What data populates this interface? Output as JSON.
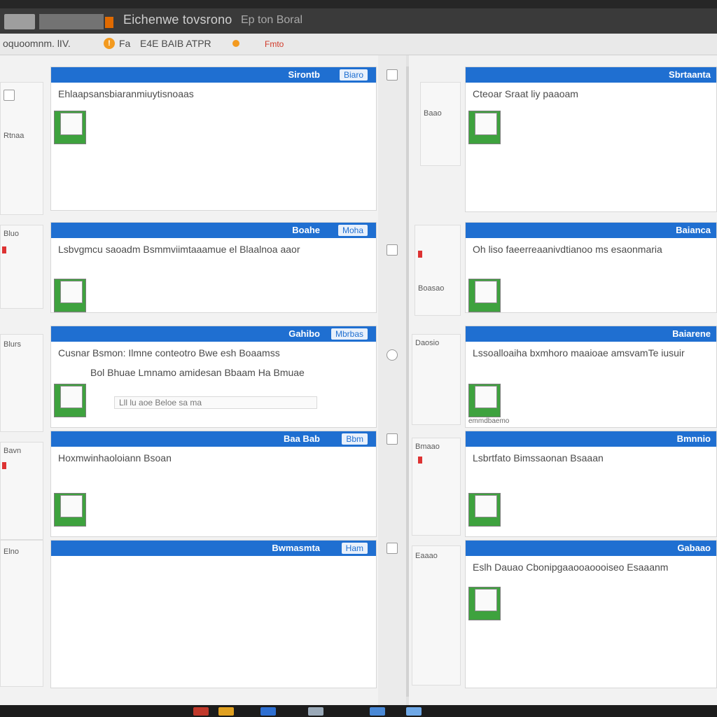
{
  "window": {
    "title": "Eichenwe tovsrono",
    "subtitle": "Ep ton Boral"
  },
  "toolbar": {
    "path_text": "oquoomnm. lIV.",
    "menu1": "Fa",
    "menu2": "E4E BAIB ATPR",
    "status_text": "Fmto",
    "warn_icon": "warning-icon"
  },
  "panels": [
    {
      "id": "p1",
      "header": "Sirontb",
      "header_btn": "Biaro",
      "title": "Ehlaapsansbiaranmiuytisnoaas",
      "thumb": "image-thumbnail"
    },
    {
      "id": "p2",
      "header": "Sbrtaanta",
      "title": "Cteoar Sraat liy paaoam",
      "thumb": "image-thumbnail"
    },
    {
      "id": "p3",
      "header": "Boahe",
      "header_btn": "Moha",
      "title": "Lsbvgmcu saoadm Bsmmviimtaaamue el Blaalnoa aaor",
      "thumb": "image-thumbnail"
    },
    {
      "id": "p4",
      "header": "Baianca",
      "title": "Oh liso faeerreaanivdtianoo ms esaonmaria",
      "thumb": "image-thumbnail"
    },
    {
      "id": "p5",
      "header": "Gahibo",
      "header_btn": "Mbrbas",
      "title": "Cusnar Bsmon: Ilmne conteotro Bwe esh Boaamss",
      "subtitle": "Bol Bhuae Lmnamo amidesan Bbaam Ha Bmuae",
      "input": "Lll lu aoe  Beloe sa ma",
      "thumb": "image-thumbnail"
    },
    {
      "id": "p6",
      "header": "Baiarene",
      "title": "Lssoalloaiha bxmhoro maaioae amsvamTe iusuir",
      "thumb": "image-thumbnail",
      "caption": "emmdbaemo"
    },
    {
      "id": "p7",
      "header": "Baa Bab",
      "header_btn": "Bbm",
      "title": "Hoxmwinhaoloiann Bsoan",
      "thumb": "image-thumbnail"
    },
    {
      "id": "p8",
      "header": "Bmnnio",
      "title": "Lsbrtfato Bimssaonan Bsaaan",
      "thumb": "image-thumbnail"
    },
    {
      "id": "p9",
      "header": "Bwmasmta",
      "header_btn": "Ham",
      "title": "",
      "thumb": "image-thumbnail"
    },
    {
      "id": "p10",
      "header": "Gabaao",
      "title": "Eslh Dauao Cbonipgaaooaoooiseo Esaaanm",
      "thumb": "image-thumbnail"
    }
  ],
  "left_sidebar": [
    {
      "label": "Rtnaa",
      "icon": "list-icon"
    },
    {
      "label": "Bluo",
      "icon": "list-icon"
    },
    {
      "label": "Blurs",
      "icon": "list-icon"
    },
    {
      "label": "Bavn",
      "icon": "list-icon"
    },
    {
      "label": "Elno",
      "icon": "list-icon"
    }
  ],
  "mid_sidebar": [
    {
      "label": "Baao",
      "icon": "document-icon"
    },
    {
      "label": "Boasao",
      "icon": "document-icon"
    },
    {
      "label": "Daosio",
      "icon": "document-icon"
    },
    {
      "label": "Bmaao",
      "icon": "document-icon"
    },
    {
      "label": "Eaaao",
      "icon": "document-icon"
    }
  ],
  "taskbar": {
    "icons": [
      "app-icon",
      "folder-icon",
      "browser-icon",
      "mail-icon",
      "app-icon",
      "app-icon"
    ]
  },
  "colors": {
    "header_blue": "#1f6fd1",
    "thumb_green": "#3ea23e",
    "warn_orange": "#f39a1f"
  }
}
